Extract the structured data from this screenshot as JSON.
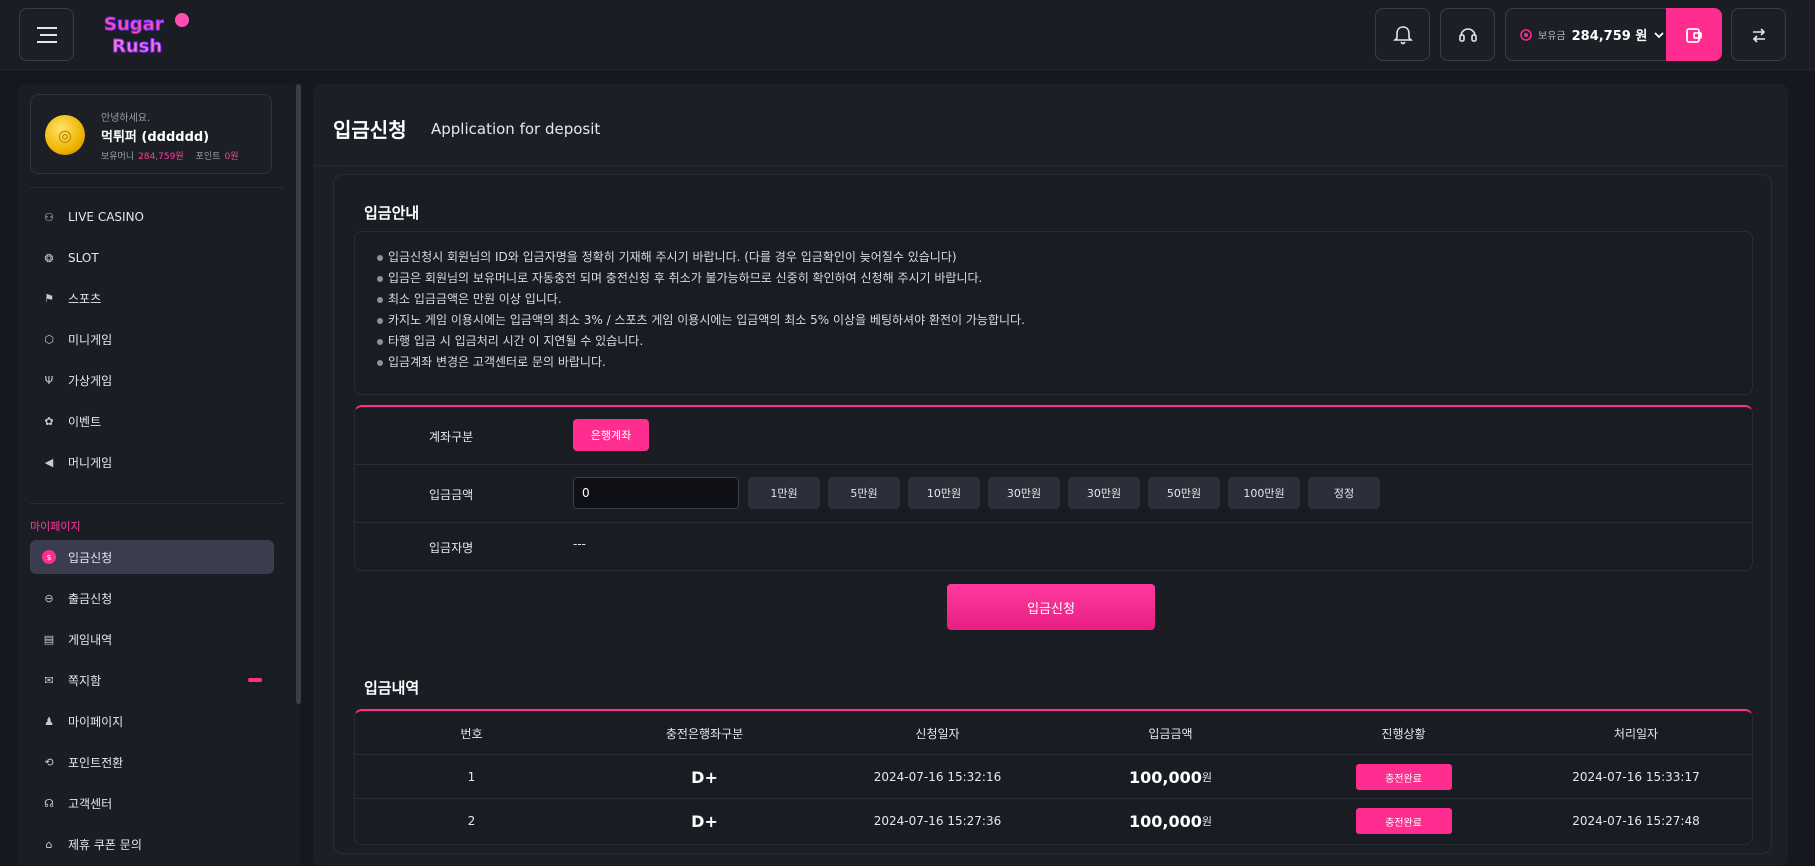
{
  "header": {
    "logo_text": "Sugar Rush",
    "wallet_label": "보유금",
    "wallet_amount": "284,759 원"
  },
  "profile": {
    "greeting": "안녕하세요.",
    "name": "먹튀퍼 (dddddd)",
    "money_label": "보유머니",
    "money_value": "284,759원",
    "point_label": "포인트",
    "point_value": "0원"
  },
  "nav": {
    "items": [
      {
        "label": "LIVE CASINO",
        "icon": "casino-chip-icon"
      },
      {
        "label": "SLOT",
        "icon": "slot-icon"
      },
      {
        "label": "스포츠",
        "icon": "flag-icon"
      },
      {
        "label": "미니게임",
        "icon": "dice-icon"
      },
      {
        "label": "가상게임",
        "icon": "antenna-icon"
      },
      {
        "label": "이벤트",
        "icon": "gift-icon"
      },
      {
        "label": "머니게임",
        "icon": "megaphone-icon"
      }
    ],
    "mypage_label": "마이페이지",
    "mypage_items": [
      {
        "label": "입금신청",
        "icon": "deposit-icon"
      },
      {
        "label": "출금신청",
        "icon": "withdraw-icon"
      },
      {
        "label": "게임내역",
        "icon": "history-icon"
      },
      {
        "label": "쪽지함",
        "icon": "mail-icon"
      },
      {
        "label": "마이페이지",
        "icon": "user-icon"
      },
      {
        "label": "포인트전환",
        "icon": "exchange-icon"
      },
      {
        "label": "고객센터",
        "icon": "headset-icon"
      },
      {
        "label": "제휴 쿠폰 문의",
        "icon": "coupon-icon"
      }
    ]
  },
  "page": {
    "title": "입금신청",
    "subtitle": "Application for deposit"
  },
  "notice": {
    "title": "입금안내",
    "lines": [
      "입금신청시 회원님의 ID와 입금자명을 정확히 기재해 주시기 바랍니다. (다를 경우 입금확인이 늦어질수 있습니다)",
      "입금은 회원님의 보유머니로 자동충전 되며 충전신청 후 취소가 불가능하므로 신중히 확인하여 신청해 주시기 바랍니다.",
      "최소 입금금액은 만원 이상 입니다.",
      "카지노 게임 이용시에는 입금액의 최소 3% / 스포츠 게임 이용시에는 입금액의 최소 5% 이상을 베팅하셔야 환전이 가능합니다.",
      "타행 입금 시 입금처리 시간 이 지연될 수 있습니다.",
      "입금계좌 변경은 고객센터로 문의 바랍니다."
    ]
  },
  "form": {
    "account_label": "계좌구분",
    "account_button": "은행계좌",
    "amount_label": "입금금액",
    "amount_value": "0",
    "quick_amounts": [
      "1만원",
      "5만원",
      "10만원",
      "30만원",
      "30만원",
      "50만원",
      "100만원",
      "정정"
    ],
    "depositor_label": "입금자명",
    "depositor_value": "---",
    "submit_label": "입금신청"
  },
  "history": {
    "title": "입금내역",
    "columns": [
      "번호",
      "충전은행좌구분",
      "신청일자",
      "입금금액",
      "진행상황",
      "처리일자"
    ],
    "rows": [
      {
        "no": "1",
        "bank": "D+",
        "requested": "2024-07-16 15:32:16",
        "amount": "100,000",
        "unit": "원",
        "status": "충전완료",
        "processed": "2024-07-16 15:33:17"
      },
      {
        "no": "2",
        "bank": "D+",
        "requested": "2024-07-16 15:27:36",
        "amount": "100,000",
        "unit": "원",
        "status": "충전완료",
        "processed": "2024-07-16 15:27:48"
      }
    ]
  },
  "colors": {
    "accent": "#ff2d8f",
    "background": "#16181f",
    "panel": "#1b1d25"
  }
}
